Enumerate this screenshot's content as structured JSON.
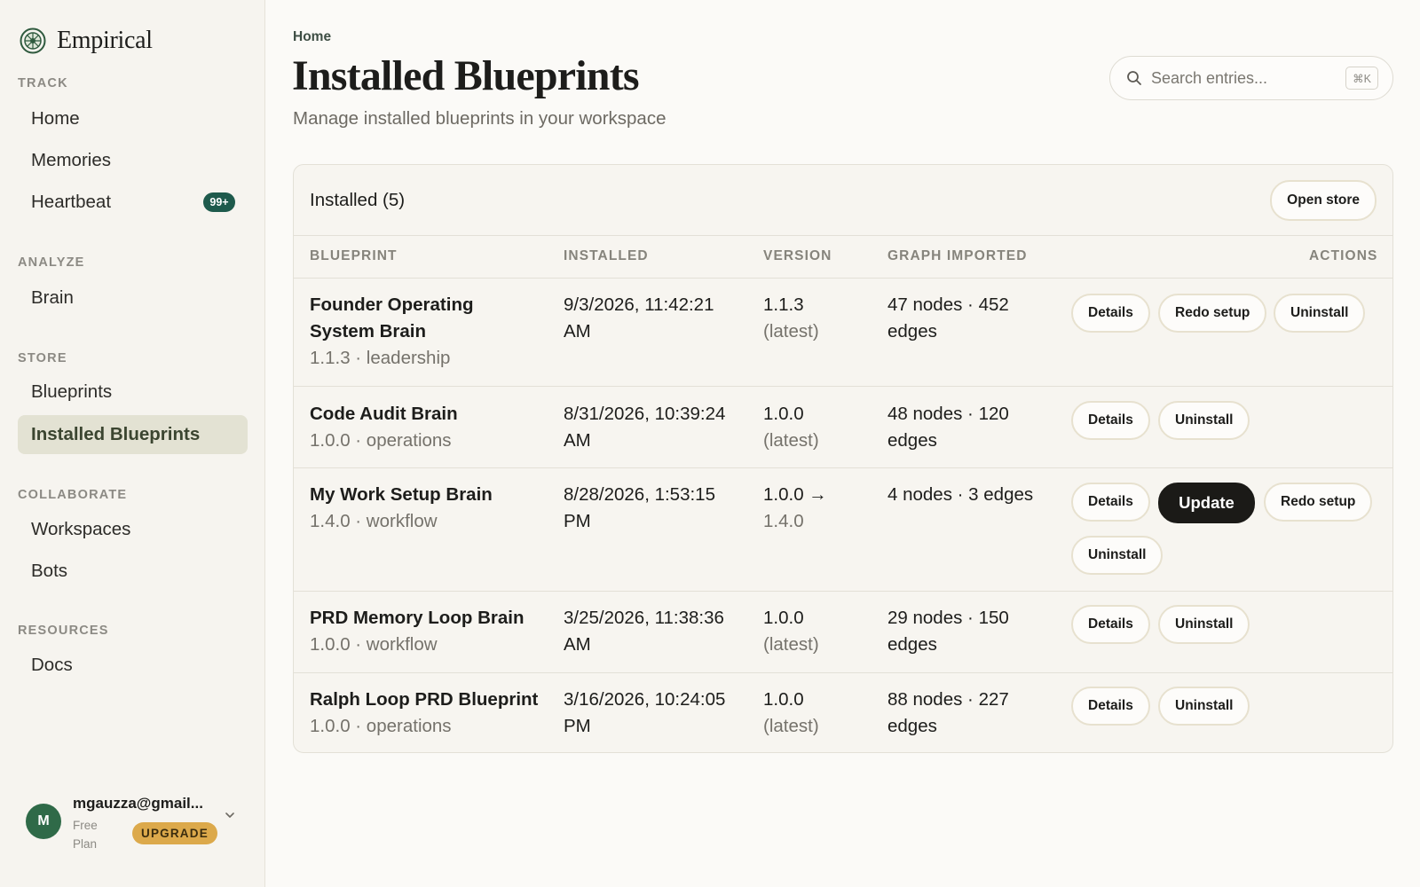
{
  "brand": {
    "name": "Empirical"
  },
  "sidebar": {
    "sections": [
      {
        "label": "TRACK"
      },
      {
        "label": "ANALYZE"
      },
      {
        "label": "STORE"
      },
      {
        "label": "COLLABORATE"
      },
      {
        "label": "RESOURCES"
      }
    ],
    "items": {
      "home": "Home",
      "memories": "Memories",
      "heartbeat": "Heartbeat",
      "heartbeat_badge": "99+",
      "brain": "Brain",
      "blueprints": "Blueprints",
      "installed_blueprints": "Installed Blueprints",
      "workspaces": "Workspaces",
      "bots": "Bots",
      "docs": "Docs"
    },
    "active_item": "installed_blueprints"
  },
  "user": {
    "initial": "M",
    "email": "mgauzza@gmail...",
    "plan": "Free Plan",
    "upgrade_label": "UPGRADE"
  },
  "header": {
    "breadcrumb": "Home",
    "title": "Installed Blueprints",
    "subtitle": "Manage installed blueprints in your workspace"
  },
  "search": {
    "placeholder": "Search entries...",
    "shortcut": "⌘K"
  },
  "panel": {
    "title": "Installed (5)",
    "open_store_label": "Open store",
    "columns": [
      "BLUEPRINT",
      "INSTALLED",
      "VERSION",
      "GRAPH IMPORTED",
      "ACTIONS"
    ],
    "rows": [
      {
        "name_line1": "Founder Operating",
        "name_line2": "System Brain",
        "meta": "1.1.3 · leadership",
        "installed_line1": "9/3/2026, 11:42:21",
        "installed_line2": "AM",
        "version_line1": "1.1.3",
        "version_line2": "(latest)",
        "graph_line1": "47 nodes · 452",
        "graph_line2": "edges",
        "actions": [
          "Details",
          "Redo setup",
          "Uninstall"
        ]
      },
      {
        "name_line1": "Code Audit Brain",
        "meta": "1.0.0 · operations",
        "installed_line1": "8/31/2026, 10:39:24",
        "installed_line2": "AM",
        "version_line1": "1.0.0",
        "version_line2": "(latest)",
        "graph_line1": "48 nodes · 120",
        "graph_line2": "edges",
        "actions": [
          "Details",
          "Uninstall"
        ]
      },
      {
        "name_line1": "My Work Setup Brain",
        "meta": "1.4.0 · workflow",
        "installed_line1": "8/28/2026, 1:53:15",
        "installed_line2": "PM",
        "version_line1": "1.0.0 →",
        "version_line2": "1.4.0",
        "graph_line1": "4 nodes · 3 edges",
        "actions": [
          "Details",
          "Update",
          "Redo setup",
          "Uninstall"
        ]
      },
      {
        "name_line1": "PRD Memory Loop Brain",
        "meta": "1.0.0 · workflow",
        "installed_line1": "3/25/2026, 11:38:36",
        "installed_line2": "AM",
        "version_line1": "1.0.0",
        "version_line2": "(latest)",
        "graph_line1": "29 nodes · 150",
        "graph_line2": "edges",
        "actions": [
          "Details",
          "Uninstall"
        ]
      },
      {
        "name_line1": "Ralph Loop PRD Blueprint",
        "meta": "1.0.0 · operations",
        "installed_line1": "3/16/2026, 10:24:05",
        "installed_line2": "PM",
        "version_line1": "1.0.0",
        "version_line2": "(latest)",
        "graph_line1": "88 nodes · 227",
        "graph_line2": "edges",
        "actions": [
          "Details",
          "Uninstall"
        ]
      }
    ]
  },
  "colors": {
    "accent_green": "#1e5a4c",
    "active_nav_bg": "#e3e2d3",
    "upgrade_gold": "#dca94b",
    "update_button": "#1b1a17"
  }
}
